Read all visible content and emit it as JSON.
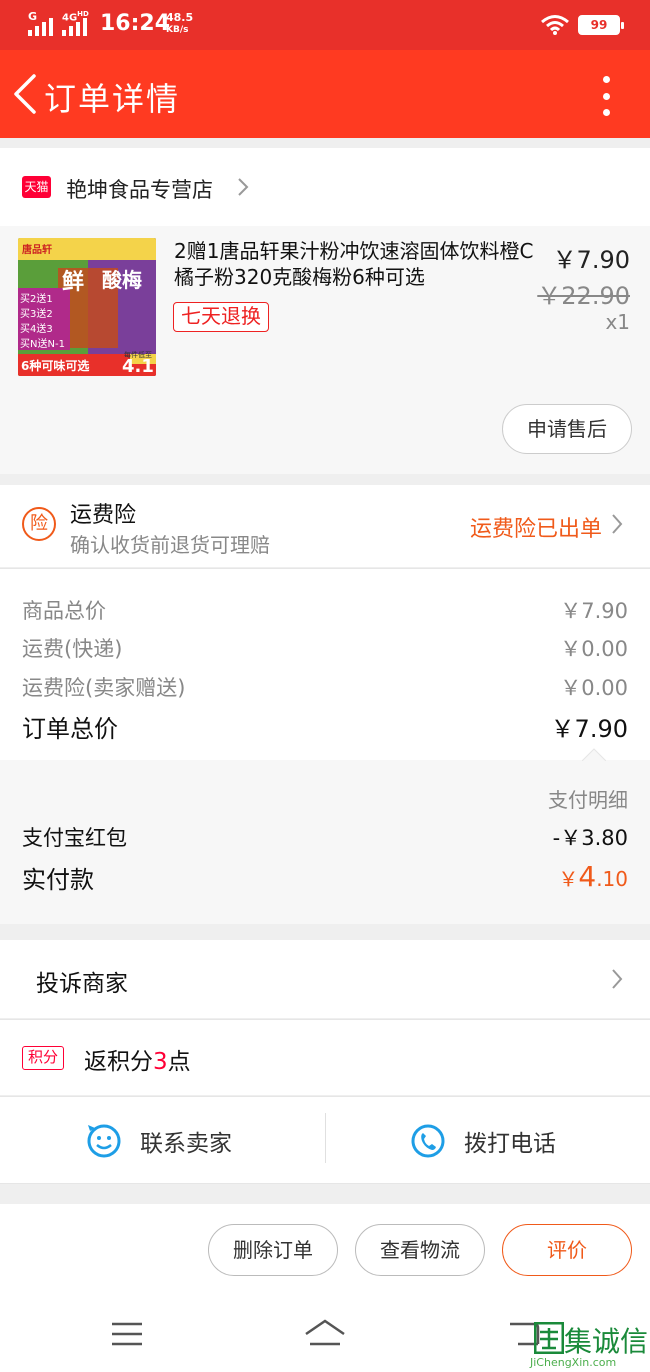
{
  "status_bar": {
    "sim1": "G",
    "sim2": "4G",
    "sim2_sup": "HD",
    "time": "16:24",
    "speed_value": "48.5",
    "speed_unit": "KB/s",
    "battery": "99",
    "color": "#e8302a"
  },
  "nav": {
    "title": "订单详情",
    "back_icon": "chevron-left-icon",
    "more_icon": "vertical-ellipsis-icon",
    "color": "#ff3a21"
  },
  "store": {
    "badge": "天猫",
    "name": "艳坤食品专营店"
  },
  "product": {
    "name": "2赠1唐品轩果汁粉冲饮速溶固体饮料橙C橘子粉320克酸梅粉6种可选",
    "tag": "七天退换",
    "price": "￥7.90",
    "original_price": "￥22.90",
    "quantity": "x1",
    "after_sale_label": "申请售后",
    "thumb": {
      "brand": "唐品轩",
      "big_text": "鲜",
      "big_text2": "酸梅",
      "promos": [
        "买2送1",
        "买3送2",
        "买4送3",
        "买N送N-1"
      ],
      "footer": "6种可味可选",
      "footer_price": "4.1",
      "footer_badge": "每件低至"
    }
  },
  "insurance": {
    "icon_text": "险",
    "title": "运费险",
    "subtitle": "确认收货前退货可理赔",
    "status": "运费险已出单",
    "accent": "#f05a1a"
  },
  "totals": {
    "rows": [
      {
        "label": "商品总价",
        "value": "￥7.90"
      },
      {
        "label": "运费(快递)",
        "value": "￥0.00"
      },
      {
        "label": "运费险(卖家赠送)",
        "value": "￥0.00"
      }
    ],
    "order_total_label": "订单总价",
    "order_total_value": "￥7.90"
  },
  "payment": {
    "detail_label": "支付明细",
    "redpacket_label": "支付宝红包",
    "redpacket_value": "-￥3.80",
    "actual_label": "实付款",
    "actual_symbol": "￥",
    "actual_int": "4",
    "actual_dec": ".10"
  },
  "complain": {
    "label": "投诉商家"
  },
  "points": {
    "badge": "积分",
    "prefix": "返积分",
    "num": "3",
    "suffix": "点"
  },
  "contact": {
    "seller_label": "联系卖家",
    "seller_icon": "chat-smile-icon",
    "phone_label": "拨打电话",
    "phone_icon": "phone-icon",
    "accent": "#1e9ee6"
  },
  "actions": {
    "delete": "删除订单",
    "logistics": "查看物流",
    "review": "评价"
  },
  "system_nav": {
    "menu_icon": "menu-icon",
    "home_icon": "home-icon",
    "back_icon": "back-icon"
  },
  "watermark": {
    "text": "集诚信",
    "sub": "JiChengXin.com"
  }
}
